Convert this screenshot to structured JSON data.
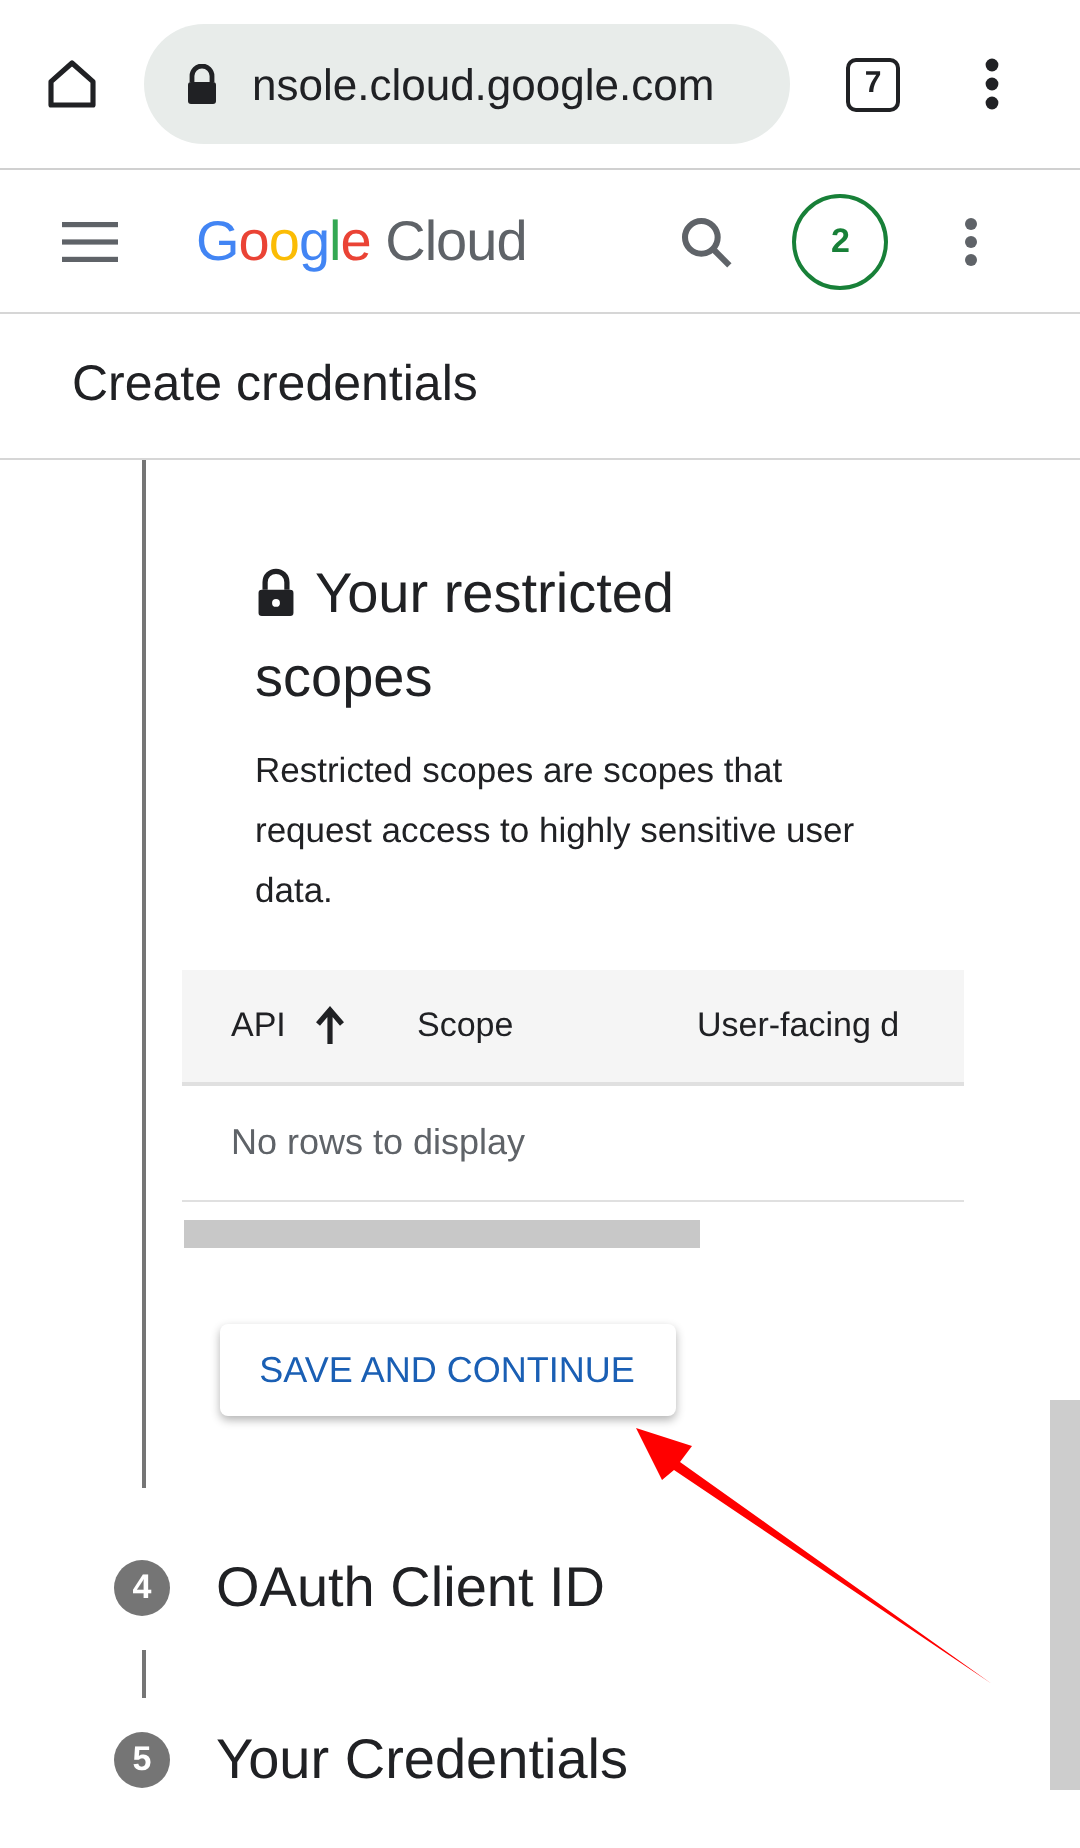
{
  "browser": {
    "url": "nsole.cloud.google.com",
    "tab_count": "7"
  },
  "app_bar": {
    "logo_word": "Google",
    "logo_product": "Cloud",
    "badge": "2"
  },
  "page_title": "Create credentials",
  "section": {
    "heading": "Your restricted scopes",
    "description": "Restricted scopes are scopes that request access to highly sensitive user data."
  },
  "table": {
    "columns": [
      {
        "label": "API",
        "sorted": true
      },
      {
        "label": "Scope",
        "sorted": false
      },
      {
        "label": "User-facing d",
        "sorted": false
      }
    ],
    "empty_text": "No rows to display"
  },
  "primary_button": "SAVE AND CONTINUE",
  "steps": [
    {
      "number": "4",
      "label": "OAuth Client ID"
    },
    {
      "number": "5",
      "label": "Your Credentials"
    }
  ]
}
